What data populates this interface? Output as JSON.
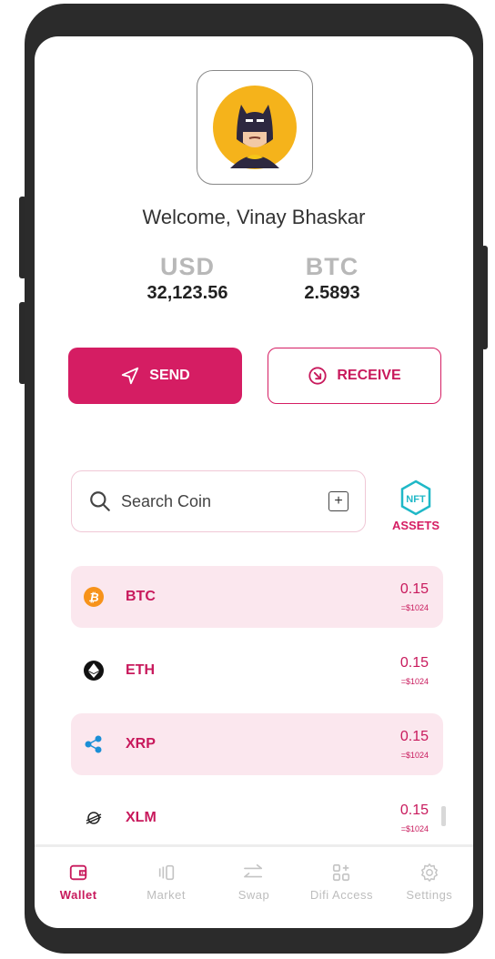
{
  "profile": {
    "welcome": "Welcome, Vinay Bhaskar"
  },
  "balances": [
    {
      "currency": "USD",
      "value": "32,123.56"
    },
    {
      "currency": "BTC",
      "value": "2.5893"
    }
  ],
  "actions": {
    "send_label": "SEND",
    "receive_label": "RECEIVE"
  },
  "search": {
    "placeholder": "Search Coin"
  },
  "assets": {
    "icon_text": "NFT",
    "label": "ASSETS"
  },
  "coins": [
    {
      "symbol": "BTC",
      "amount": "0.15",
      "usd": "=$1024",
      "icon": "bitcoin-icon",
      "color": "#f7931a"
    },
    {
      "symbol": "ETH",
      "amount": "0.15",
      "usd": "=$1024",
      "icon": "ethereum-icon",
      "color": "#111111"
    },
    {
      "symbol": "XRP",
      "amount": "0.15",
      "usd": "=$1024",
      "icon": "ripple-icon",
      "color": "#1a8fd6"
    },
    {
      "symbol": "XLM",
      "amount": "0.15",
      "usd": "=$1024",
      "icon": "stellar-icon",
      "color": "#222222"
    }
  ],
  "tabs": [
    {
      "label": "Wallet",
      "icon": "wallet-icon",
      "active": true
    },
    {
      "label": "Market",
      "icon": "market-icon"
    },
    {
      "label": "Swap",
      "icon": "swap-icon"
    },
    {
      "label": "Difi Access",
      "icon": "difi-access-icon"
    },
    {
      "label": "Settings",
      "icon": "settings-icon"
    }
  ],
  "colors": {
    "accent": "#d51d63",
    "row_highlight": "#fbe7ee"
  }
}
